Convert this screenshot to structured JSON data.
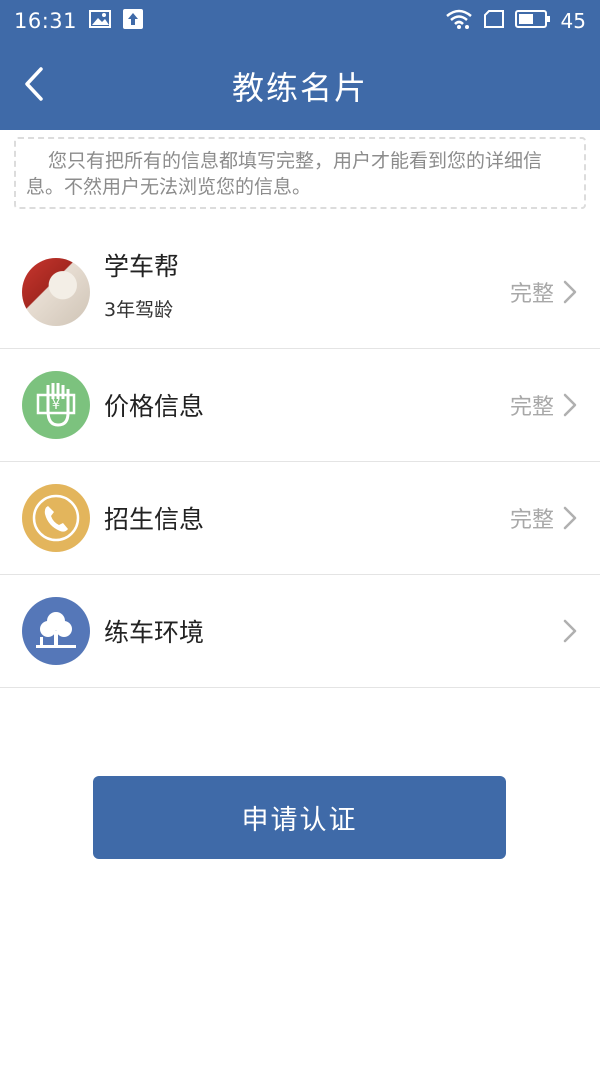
{
  "status_bar": {
    "time": "16:31",
    "battery": "45",
    "icons": [
      "image-icon",
      "upload-icon",
      "wifi-icon",
      "sim-icon",
      "battery-icon"
    ]
  },
  "nav": {
    "title": "教练名片",
    "back_icon": "chevron-left-icon"
  },
  "notice": {
    "text": "您只有把所有的信息都填写完整，用户才能看到您的详细信息。不然用户无法浏览您的信息。"
  },
  "profile": {
    "name": "学车帮",
    "experience": "3年驾龄",
    "status": "完整"
  },
  "items": [
    {
      "label": "价格信息",
      "status": "完整",
      "icon": "price-hand-icon",
      "color": "#7cc27e"
    },
    {
      "label": "招生信息",
      "status": "完整",
      "icon": "phone-icon",
      "color": "#e3b55c"
    },
    {
      "label": "练车环境",
      "status": "",
      "icon": "tree-icon",
      "color": "#5577b8"
    }
  ],
  "actions": {
    "apply_label": "申请认证"
  },
  "colors": {
    "primary": "#3f6aa8",
    "status_text": "#a8a8a8"
  }
}
